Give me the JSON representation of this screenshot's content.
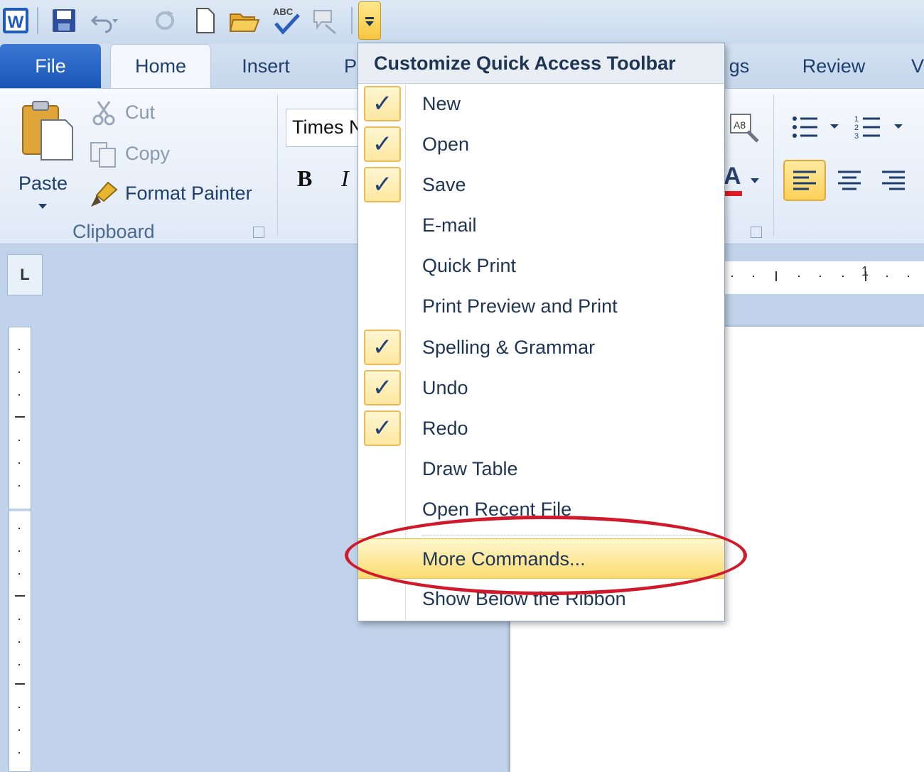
{
  "qat": {
    "icons": [
      "word-logo-icon",
      "save-icon",
      "undo-icon",
      "redo-icon",
      "new-icon",
      "open-icon",
      "spelling-icon",
      "comment-icon",
      "customize-dropdown-icon"
    ]
  },
  "tabs": {
    "file": "File",
    "home": "Home",
    "insert": "Insert",
    "partial_p": "P",
    "partial_gs": "gs",
    "review": "Review",
    "partial_v": "V"
  },
  "clipboard": {
    "paste": "Paste",
    "cut": "Cut",
    "copy": "Copy",
    "format_painter": "Format Painter",
    "group": "Clipboard"
  },
  "font": {
    "name": "Times N",
    "bold": "B",
    "italic": "I",
    "color_glyph": "A"
  },
  "ruler": {
    "h_mark": "1"
  },
  "tab_selector": "L",
  "menu": {
    "title": "Customize Quick Access Toolbar",
    "items": [
      {
        "label": "New",
        "checked": true
      },
      {
        "label": "Open",
        "checked": true
      },
      {
        "label": "Save",
        "checked": true
      },
      {
        "label": "E-mail",
        "checked": false
      },
      {
        "label": "Quick Print",
        "checked": false
      },
      {
        "label": "Print Preview and Print",
        "checked": false
      },
      {
        "label": "Spelling & Grammar",
        "checked": true
      },
      {
        "label": "Undo",
        "checked": true
      },
      {
        "label": "Redo",
        "checked": true
      },
      {
        "label": "Draw Table",
        "checked": false
      },
      {
        "label": "Open Recent File",
        "checked": false
      }
    ],
    "check_glyph": "✓",
    "more_commands": "More Commands...",
    "show_below": "Show Below the Ribbon"
  },
  "colors": {
    "highlight_ring": "#d0192a",
    "hover": "#fcdc70",
    "file_tab": "#1a56b5"
  }
}
